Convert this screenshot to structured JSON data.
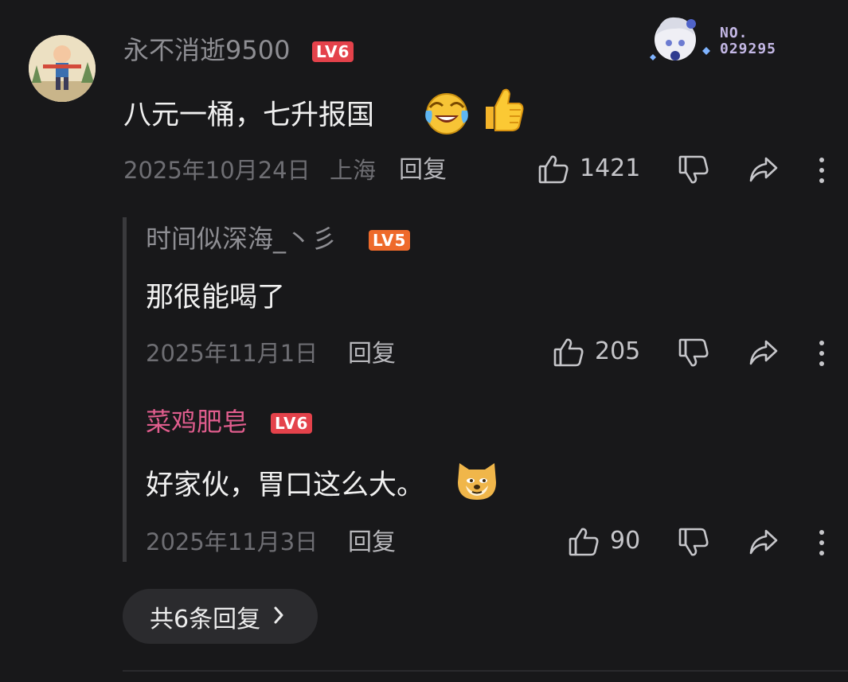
{
  "main_comment": {
    "username": "永不消逝9500",
    "level": "LV6",
    "text": "八元一桶，七升报国",
    "emoji_laugh": "laughing-crying-face",
    "emoji_thumb": "👍",
    "date": "2025年10月24日",
    "location": "上海",
    "reply_label": "回复",
    "likes": "1421",
    "badge_no_label": "NO.",
    "badge_no_value": "029295"
  },
  "replies": [
    {
      "username": "时间似深海_丶彡",
      "level": "LV5",
      "text": "那很能喝了",
      "date": "2025年11月1日",
      "reply_label": "回复",
      "likes": "205"
    },
    {
      "username": "菜鸡肥皂",
      "level": "LV6",
      "text": "好家伙，胃口这么大。",
      "emoji": "doge-face",
      "date": "2025年11月3日",
      "reply_label": "回复",
      "likes": "90"
    }
  ],
  "more_replies_label": "共6条回复",
  "colors": {
    "background": "#18181a",
    "username_gray": "#8e8e93",
    "username_pink": "#e05d8d",
    "level_red": "#e4424b",
    "level_orange": "#ee6a2b"
  }
}
